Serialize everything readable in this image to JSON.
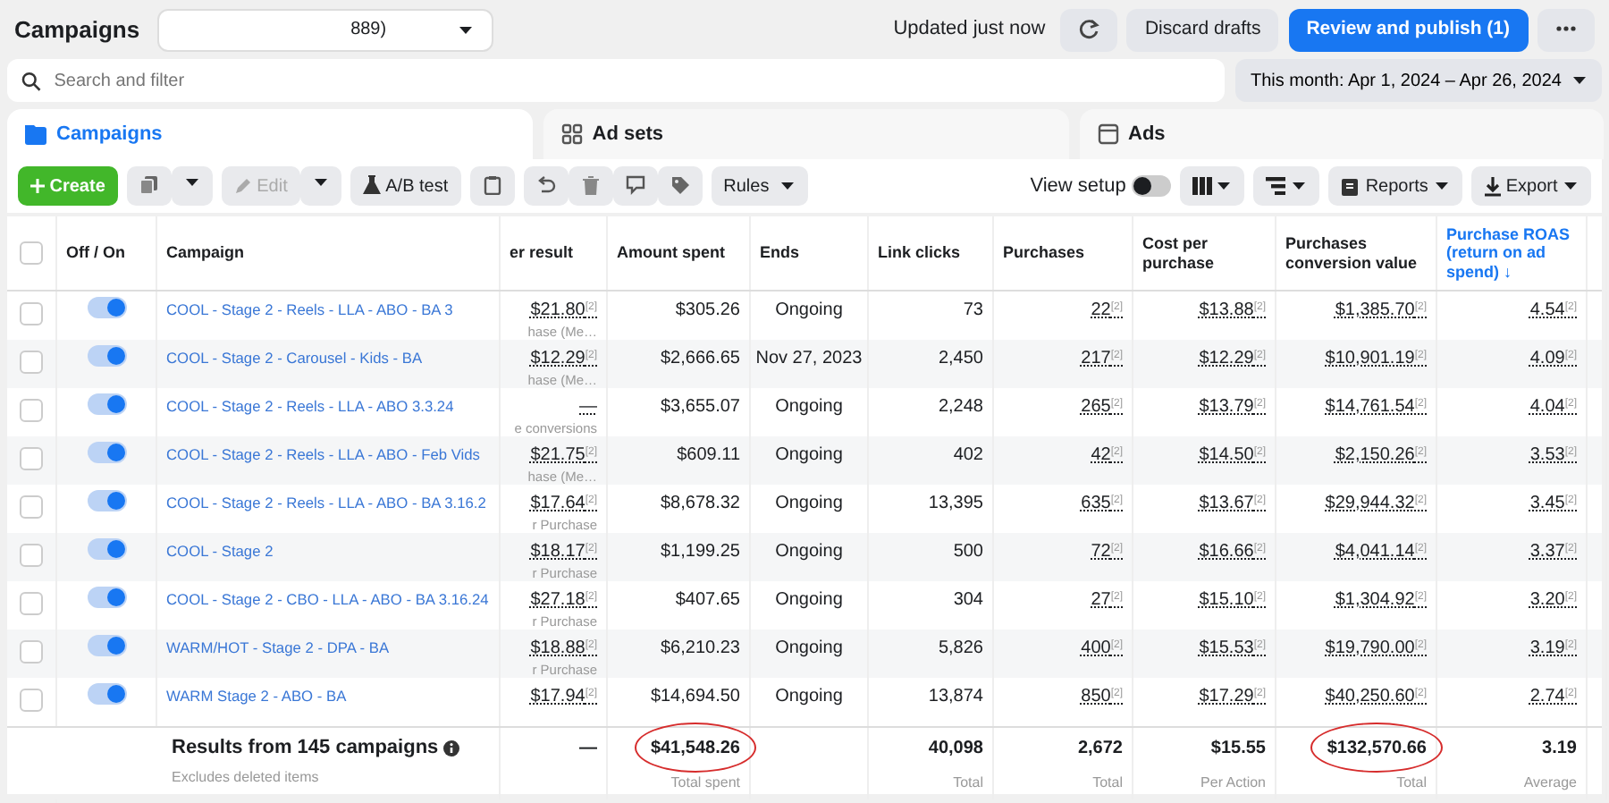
{
  "header": {
    "title": "Campaigns",
    "account_selector": "889)",
    "update_status": "Updated just now",
    "buttons": [
      {
        "label": "Discard drafts",
        "kind": "secondary"
      },
      {
        "label": "Review and publish (1)",
        "kind": "primary"
      }
    ]
  },
  "search": {
    "placeholder": "Search and filter"
  },
  "date_range": "This month: Apr 1, 2024 – Apr 26, 2024",
  "tabs": [
    {
      "label": "Campaigns",
      "selected": true
    },
    {
      "label": "Ad sets",
      "selected": false
    },
    {
      "label": "Ads",
      "selected": false
    }
  ],
  "toolbar": {
    "create": "Create",
    "edit": {
      "label": "Edit",
      "disabled": true
    },
    "ab_test": "A/B test",
    "rules": "Rules",
    "view_setup": {
      "label": "View setup",
      "on": false
    },
    "reports": "Reports",
    "export": "Export"
  },
  "table": {
    "all_selected": false,
    "columns": [
      {
        "label": "Off / On",
        "sorted": false
      },
      {
        "label": "Campaign",
        "sorted": false
      },
      {
        "label": "er result",
        "sorted": false
      },
      {
        "label": "Amount spent",
        "sorted": false
      },
      {
        "label": "Ends",
        "sorted": false
      },
      {
        "label": "Link clicks",
        "sorted": false
      },
      {
        "label": "Purchases",
        "sorted": false
      },
      {
        "label": "Cost per purchase",
        "sorted": false
      },
      {
        "label": "Purchases conversion value",
        "sorted": false
      },
      {
        "label": "Purchase ROAS (return on ad spend) ↓",
        "sorted": true
      }
    ],
    "rows": [
      {
        "selected": false,
        "on": true,
        "campaign": "COOL - Stage 2 - Reels - LLA - ABO - BA 3",
        "cost_per_result": "$21.80$^{[2]}$",
        "cost_per_result_note": "hase (Me…",
        "amount_spent": "$305.26",
        "ends": "Ongoing",
        "link_clicks": "73",
        "purchases": "22$^{[2]}$",
        "cost_per_purchase": "$13.88$^{[2]}$",
        "conversion_value": "$1,385.70$^{[2]}$",
        "roas": "4.54$^{[2]}$"
      },
      {
        "selected": false,
        "on": true,
        "campaign": "COOL - Stage 2 - Carousel - Kids - BA",
        "cost_per_result": "$12.29$^{[2]}$",
        "cost_per_result_note": "hase (Me…",
        "amount_spent": "$2,666.65",
        "ends": "Nov 27, 2023",
        "link_clicks": "2,450",
        "purchases": "217$^{[2]}$",
        "cost_per_purchase": "$12.29$^{[2]}$",
        "conversion_value": "$10,901.19$^{[2]}$",
        "roas": "4.09$^{[2]}$"
      },
      {
        "selected": false,
        "on": true,
        "campaign": "COOL - Stage 2 - Reels - LLA - ABO 3.3.24",
        "cost_per_result": "—",
        "cost_per_result_note": "e conversions",
        "amount_spent": "$3,655.07",
        "ends": "Ongoing",
        "link_clicks": "2,248",
        "purchases": "265$^{[2]}$",
        "cost_per_purchase": "$13.79$^{[2]}$",
        "conversion_value": "$14,761.54$^{[2]}$",
        "roas": "4.04$^{[2]}$"
      },
      {
        "selected": false,
        "on": true,
        "campaign": "COOL - Stage 2 - Reels - LLA - ABO - Feb Vids",
        "cost_per_result": "$21.75$^{[2]}$",
        "cost_per_result_note": "hase (Me…",
        "amount_spent": "$609.11",
        "ends": "Ongoing",
        "link_clicks": "402",
        "purchases": "42$^{[2]}$",
        "cost_per_purchase": "$14.50$^{[2]}$",
        "conversion_value": "$2,150.26$^{[2]}$",
        "roas": "3.53$^{[2]}$"
      },
      {
        "selected": false,
        "on": true,
        "campaign": "COOL - Stage 2 - Reels - LLA - ABO - BA 3.16.2",
        "cost_per_result": "$17.64$^{[2]}$",
        "cost_per_result_note": "r Purchase",
        "amount_spent": "$8,678.32",
        "ends": "Ongoing",
        "link_clicks": "13,395",
        "purchases": "635$^{[2]}$",
        "cost_per_purchase": "$13.67$^{[2]}$",
        "conversion_value": "$29,944.32$^{[2]}$",
        "roas": "3.45$^{[2]}$"
      },
      {
        "selected": false,
        "on": true,
        "campaign": "COOL - Stage 2",
        "cost_per_result": "$18.17$^{[2]}$",
        "cost_per_result_note": "r Purchase",
        "amount_spent": "$1,199.25",
        "ends": "Ongoing",
        "link_clicks": "500",
        "purchases": "72$^{[2]}$",
        "cost_per_purchase": "$16.66$^{[2]}$",
        "conversion_value": "$4,041.14$^{[2]}$",
        "roas": "3.37$^{[2]}$"
      },
      {
        "selected": false,
        "on": true,
        "campaign": "COOL - Stage 2 - CBO - LLA - ABO - BA 3.16.24",
        "cost_per_result": "$27.18$^{[2]}$",
        "cost_per_result_note": "r Purchase",
        "amount_spent": "$407.65",
        "ends": "Ongoing",
        "link_clicks": "304",
        "purchases": "27$^{[2]}$",
        "cost_per_purchase": "$15.10$^{[2]}$",
        "conversion_value": "$1,304.92$^{[2]}$",
        "roas": "3.20$^{[2]}$"
      },
      {
        "selected": false,
        "on": true,
        "campaign": "WARM/HOT - Stage 2 - DPA - BA",
        "cost_per_result": "$18.88$^{[2]}$",
        "cost_per_result_note": "r Purchase",
        "amount_spent": "$6,210.23",
        "ends": "Ongoing",
        "link_clicks": "5,826",
        "purchases": "400$^{[2]}$",
        "cost_per_purchase": "$15.53$^{[2]}$",
        "conversion_value": "$19,790.00$^{[2]}$",
        "roas": "3.19$^{[2]}$"
      },
      {
        "selected": false,
        "on": true,
        "campaign": "WARM Stage 2 - ABO - BA",
        "cost_per_result": "$17.94$^{[2]}$",
        "amount_spent": "$14,694.50",
        "ends": "Ongoing",
        "link_clicks": "13,874",
        "purchases": "850$^{[2]}$",
        "cost_per_purchase": "$17.29$^{[2]}$",
        "conversion_value": "$40,250.60$^{[2]}$",
        "roas": "2.74$^{[2]}$"
      }
    ]
  },
  "footer": {
    "title": "Results from 145 campaigns",
    "note": "Excludes deleted items",
    "cells": [
      {
        "value": "—",
        "circled": false
      },
      {
        "value": "$41,548.26",
        "label": "Total spent",
        "circled": true
      },
      {
        "circled": false
      },
      {
        "value": "40,098",
        "label": "Total",
        "circled": false
      },
      {
        "value": "2,672",
        "label": "Total",
        "circled": false
      },
      {
        "value": "$15.55",
        "label": "Per Action",
        "circled": false
      },
      {
        "value": "$132,570.66",
        "label": "Total",
        "circled": true
      },
      {
        "value": "3.19",
        "label": "Average",
        "circled": false
      }
    ]
  }
}
